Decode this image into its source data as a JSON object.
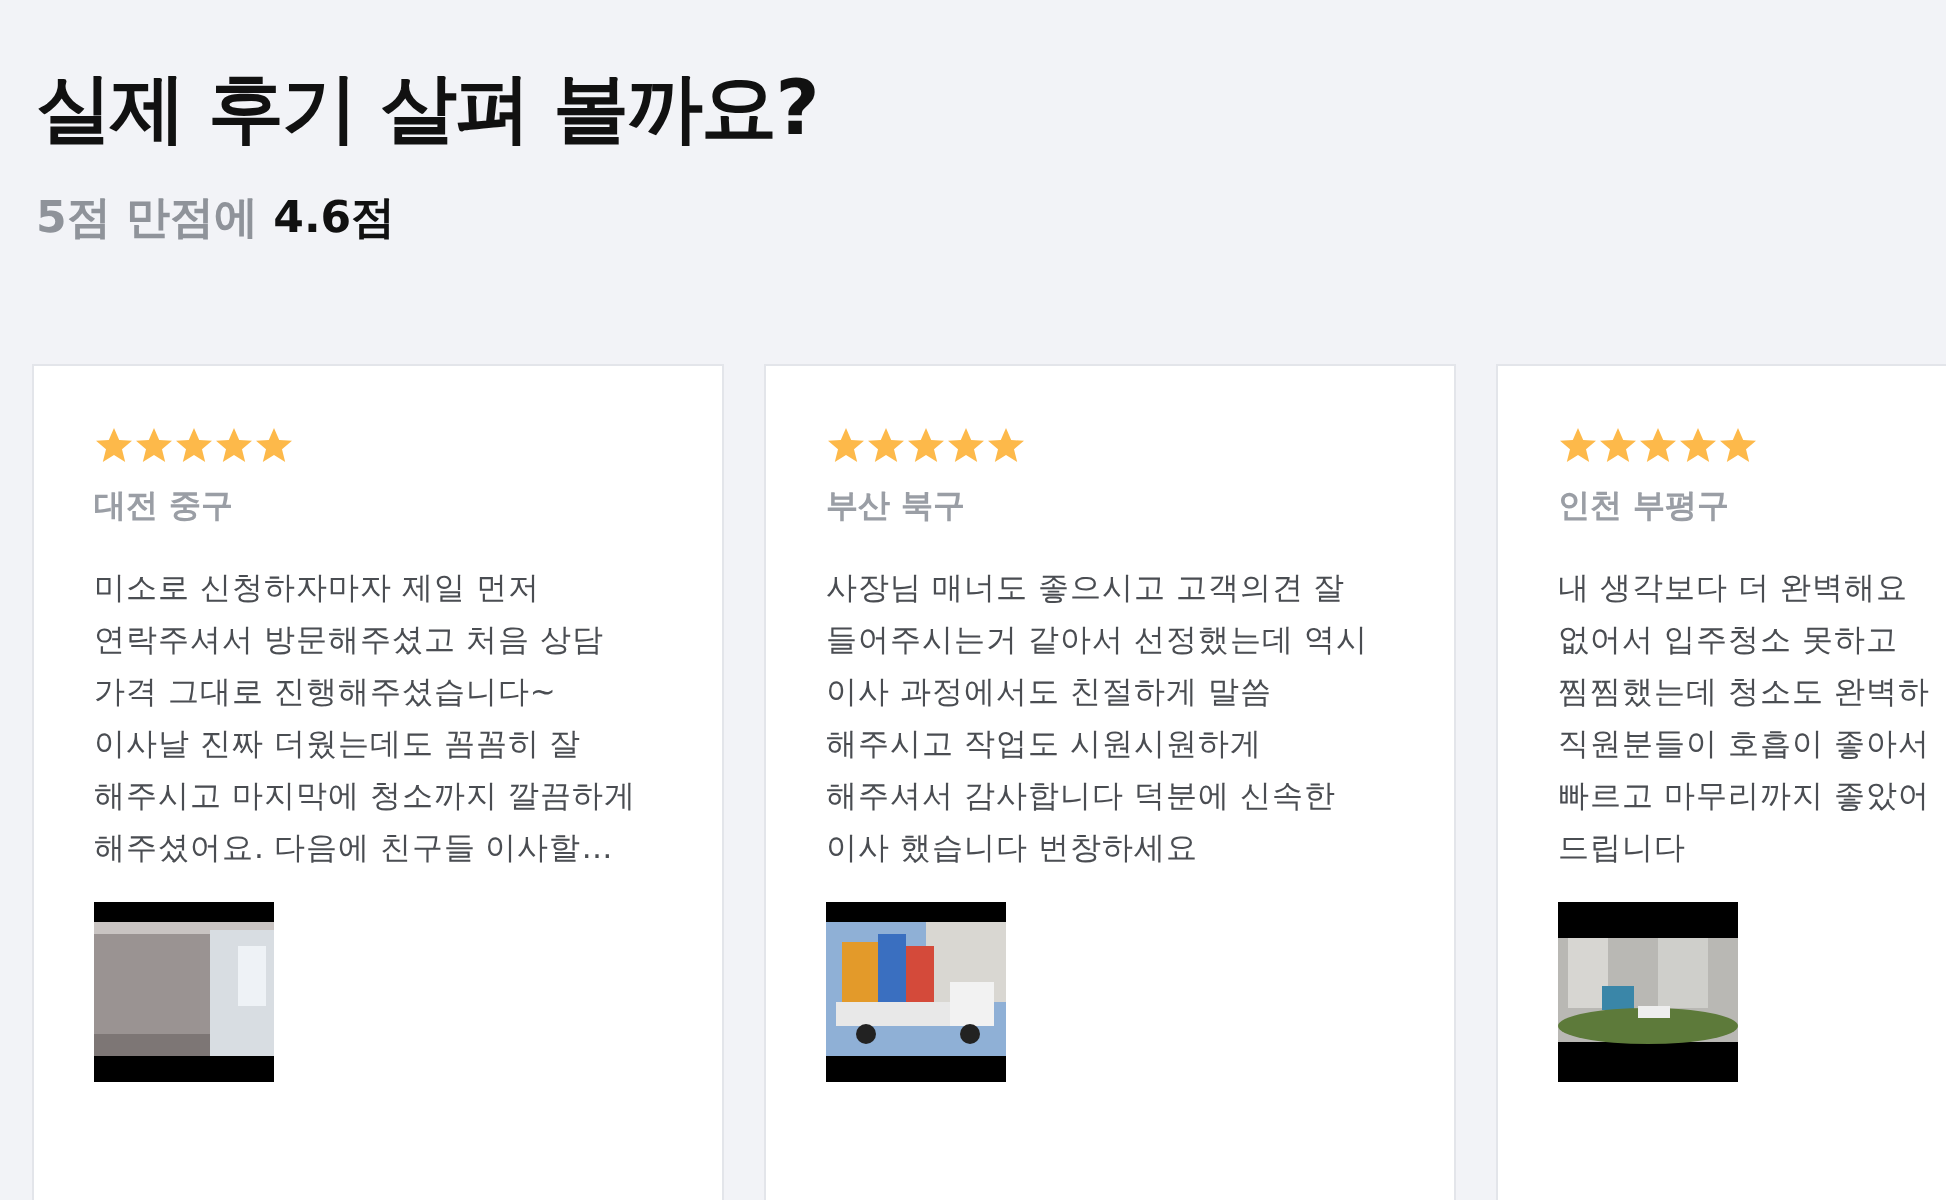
{
  "heading": "실제 후기 살펴 볼까요?",
  "subheading": "5점 만점에 **4.6점**",
  "reviews": [
    {
      "stars": 5,
      "location": "대전 중구",
      "lines": [
        "미소로 신청하자마자 제일 먼저",
        "연락주셔서 방문해주셨고 처음 상담",
        "가격 그대로 진행해주셨습니다~",
        "이사날 진짜 더웠는데도 꼼꼼히 잘",
        "해주시고 마지막에 청소까지 깔끔하게",
        "해주셨어요. 다음에 친구들 이사할…"
      ]
    },
    {
      "stars": 5,
      "location": "부산 북구",
      "lines": [
        "사장님 매너도 좋으시고 고객의견 잘",
        "들어주시는거 같아서 선정했는데 역시",
        "이사 과정에서도 친절하게 말씀",
        "해주시고 작업도 시원시원하게",
        "해주셔서 감사합니다 덕분에 신속한",
        "이사 했습니다 번창하세요"
      ]
    },
    {
      "stars": 5,
      "location": "인천 부평구",
      "lines": [
        "내 생각보다 더 완벽해요",
        "없어서 입주청소 못하고",
        "찜찜했는데 청소도 완벽하",
        "직원분들이 호흡이 좋아서",
        "빠르고 마무리까지 좋았어",
        "드립니다"
      ]
    }
  ]
}
